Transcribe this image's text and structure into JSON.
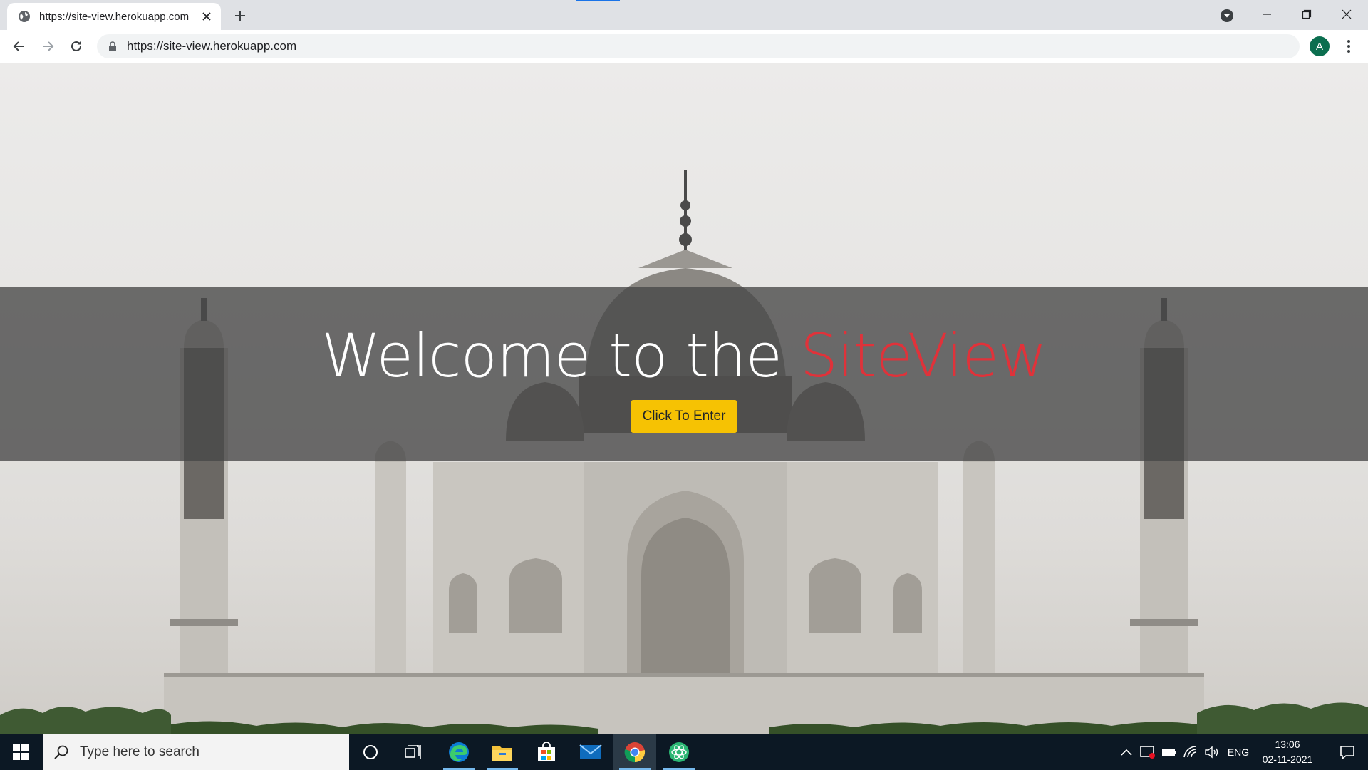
{
  "browser": {
    "tab": {
      "title": "https://site-view.herokuapp.com",
      "favicon": "globe-icon",
      "close_icon": "close-icon"
    },
    "new_tab_icon": "plus-icon",
    "tab_search_icon": "chevron-down-circle-icon",
    "window_controls": [
      "minimize-icon",
      "restore-icon",
      "close-icon"
    ],
    "toolbar": {
      "back_icon": "arrow-left-icon",
      "forward_icon": "arrow-right-icon",
      "reload_icon": "reload-icon",
      "lock_icon": "lock-icon",
      "url": "https://site-view.herokuapp.com",
      "profile_initial": "A",
      "profile_color": "#0b6e4f",
      "menu_icon": "kebab-menu-icon"
    }
  },
  "page": {
    "headline_prefix": "Welcome to the ",
    "headline_brand": "SiteView",
    "brand_color": "#e0323a",
    "enter_button": "Click To Enter",
    "enter_button_color": "#f6c203",
    "background": "taj-mahal-photo"
  },
  "taskbar": {
    "search_placeholder": "Type here to search",
    "apps": [
      "cortana-icon",
      "task-view-icon",
      "edge-icon",
      "file-explorer-icon",
      "microsoft-store-icon",
      "mail-icon",
      "chrome-icon",
      "app-icon"
    ],
    "active_app": "chrome-icon",
    "tray": {
      "language": "ENG",
      "time": "13:06",
      "date": "02-11-2021"
    }
  }
}
